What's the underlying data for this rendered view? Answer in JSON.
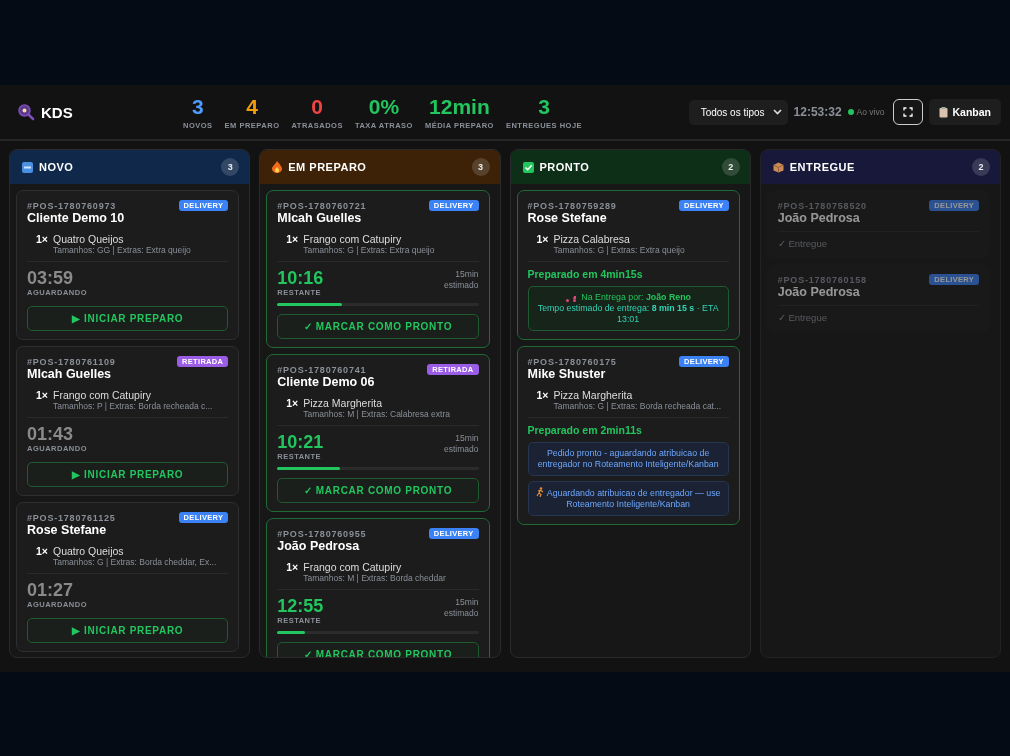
{
  "header": {
    "logo": "KDS",
    "stats": [
      {
        "value": "3",
        "label": "NOVOS",
        "color": "#4d9bff"
      },
      {
        "value": "4",
        "label": "EM PREPARO",
        "color": "#f59e0b"
      },
      {
        "value": "0",
        "label": "ATRASADOS",
        "color": "#ef4444"
      },
      {
        "value": "0%",
        "label": "TAXA ATRASO",
        "color": "#22c55e"
      },
      {
        "value": "12min",
        "label": "MÉDIA PREPARO",
        "color": "#22c55e"
      },
      {
        "value": "3",
        "label": "ENTREGUES HOJE",
        "color": "#22c55e"
      }
    ],
    "filter": {
      "value": "Todos os tipos"
    },
    "clock": "12:53:32",
    "live": {
      "label": "Ao vivo",
      "on": true
    },
    "kanban_button": "Kanban"
  },
  "columns": [
    {
      "title": "NOVO",
      "count": "3",
      "kind": "novo",
      "color": "#10284a",
      "orders": [
        {
          "kind": "waiting",
          "id": "#POS-1780760973",
          "customer": "Cliente Demo 10",
          "badge": {
            "label": "DELIVERY",
            "kind": "delivery"
          },
          "items": [
            {
              "qty": "1×",
              "name": "Quatro Queijos",
              "details": "Tamanhos: GG | Extras: Extra queijo"
            }
          ],
          "timer": "03:59",
          "timer_label": "AGUARDANDO",
          "action": "▶ INICIAR PREPARO"
        },
        {
          "kind": "waiting",
          "id": "#POS-1780761109",
          "customer": "MIcah Guelles",
          "badge": {
            "label": "RETIRADA",
            "kind": "retirada"
          },
          "items": [
            {
              "qty": "1×",
              "name": "Frango com Catupiry",
              "details": "Tamanhos: P | Extras: Borda recheada c..."
            }
          ],
          "timer": "01:43",
          "timer_label": "AGUARDANDO",
          "action": "▶ INICIAR PREPARO"
        },
        {
          "kind": "waiting",
          "id": "#POS-1780761125",
          "customer": "Rose Stefane",
          "badge": {
            "label": "DELIVERY",
            "kind": "delivery"
          },
          "items": [
            {
              "qty": "1×",
              "name": "Quatro Queijos",
              "details": "Tamanhos: G | Extras: Borda cheddar, Ex..."
            }
          ],
          "timer": "01:27",
          "timer_label": "AGUARDANDO",
          "action": "▶ INICIAR PREPARO"
        }
      ]
    },
    {
      "title": "EM PREPARO",
      "count": "3",
      "kind": "preparo",
      "color": "#3d2208",
      "orders": [
        {
          "kind": "preparing",
          "id": "#POS-1780760721",
          "customer": "MIcah Guelles",
          "badge": {
            "label": "DELIVERY",
            "kind": "delivery"
          },
          "items": [
            {
              "qty": "1×",
              "name": "Frango com Catupiry",
              "details": "Tamanhos: G | Extras: Extra queijo"
            }
          ],
          "timer": "10:16",
          "timer_label": "RESTANTE",
          "estimate": "15min",
          "estimate_label": "estimado",
          "level": 0.32,
          "action": "✓ MARCAR COMO PRONTO"
        },
        {
          "kind": "preparing",
          "id": "#POS-1780760741",
          "customer": "Cliente Demo 06",
          "badge": {
            "label": "RETIRADA",
            "kind": "retirada"
          },
          "items": [
            {
              "qty": "1×",
              "name": "Pizza Margherita",
              "details": "Tamanhos: M | Extras: Calabresa extra"
            }
          ],
          "timer": "10:21",
          "timer_label": "RESTANTE",
          "estimate": "15min",
          "estimate_label": "estimado",
          "level": 0.31,
          "action": "✓ MARCAR COMO PRONTO"
        },
        {
          "kind": "preparing",
          "id": "#POS-1780760955",
          "customer": "João Pedrosa",
          "badge": {
            "label": "DELIVERY",
            "kind": "delivery"
          },
          "items": [
            {
              "qty": "1×",
              "name": "Frango com Catupiry",
              "details": "Tamanhos: M | Extras: Borda cheddar"
            }
          ],
          "timer": "12:55",
          "timer_label": "RESTANTE",
          "estimate": "15min",
          "estimate_label": "estimado",
          "level": 0.14,
          "action": "✓ MARCAR COMO PRONTO"
        }
      ]
    },
    {
      "title": "PRONTO",
      "count": "2",
      "kind": "pronto",
      "color": "#0d2e17",
      "orders": [
        {
          "kind": "ready",
          "id": "#POS-1780759289",
          "customer": "Rose Stefane",
          "badge": {
            "label": "DELIVERY",
            "kind": "delivery"
          },
          "items": [
            {
              "qty": "1×",
              "name": "Pizza Calabresa",
              "details": "Tamanhos: G | Extras: Extra queijo"
            }
          ],
          "prepared": "Preparado em 4min15s",
          "notes": [
            {
              "kind": "courier",
              "lines": [
                "Na Entrega por: **João Reno**",
                "Tempo estimado de entrega: **8 min 15 s** · ETA 13:01"
              ]
            }
          ]
        },
        {
          "kind": "ready",
          "id": "#POS-1780760175",
          "customer": "Mike Shuster",
          "badge": {
            "label": "DELIVERY",
            "kind": "delivery"
          },
          "items": [
            {
              "qty": "1×",
              "name": "Pizza Margherita",
              "details": "Tamanhos: G | Extras: Borda recheada cat..."
            }
          ],
          "prepared": "Preparado em 2min11s",
          "notes": [
            {
              "kind": "info",
              "lines": [
                "Pedido pronto - aguardando atribuicao de entregador no Roteamento Inteligente/Kanban"
              ]
            },
            {
              "kind": "waiting",
              "lines": [
                "Aguardando atribuicao de entregador — use Roteamento Inteligente/Kanban"
              ]
            }
          ]
        }
      ]
    },
    {
      "title": "ENTREGUE",
      "count": "2",
      "kind": "entregue",
      "color": "#17183a",
      "orders": [
        {
          "kind": "delivered",
          "id": "#POS-1780758520",
          "customer": "João Pedrosa",
          "badge": {
            "label": "DELIVERY",
            "kind": "delivery"
          },
          "status": "✓ Entregue"
        },
        {
          "kind": "delivered",
          "id": "#POS-1780760158",
          "customer": "João Pedrosa",
          "badge": {
            "label": "DELIVERY",
            "kind": "delivery"
          },
          "status": "✓ Entregue"
        }
      ]
    }
  ]
}
